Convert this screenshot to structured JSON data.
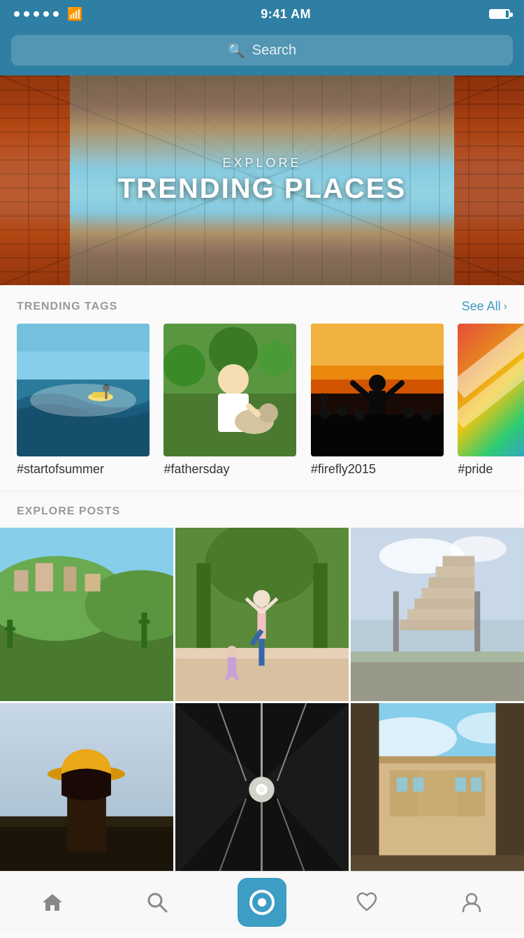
{
  "status_bar": {
    "time": "9:41 AM",
    "signal_dots": 5,
    "has_wifi": true,
    "battery_pct": 85
  },
  "search": {
    "placeholder": "Search"
  },
  "hero": {
    "explore_label": "EXPLORE",
    "title": "TRENDING PLACES"
  },
  "trending_tags": {
    "section_title": "TRENDING TAGS",
    "see_all_label": "See All",
    "tags": [
      {
        "name": "#startofsummer",
        "photo_class": "photo-surf"
      },
      {
        "name": "#fathersday",
        "photo_class": "photo-dog"
      },
      {
        "name": "#firefly2015",
        "photo_class": "photo-concert"
      },
      {
        "name": "#pride",
        "photo_class": "photo-pride"
      }
    ]
  },
  "explore_posts": {
    "section_title": "EXPLORE POSTS",
    "posts": [
      {
        "photo_class": "post-cityscape",
        "alt": "City hillside view"
      },
      {
        "photo_class": "post-yoga",
        "alt": "Yoga in garden"
      },
      {
        "photo_class": "post-stairs",
        "alt": "Outdoor stairs"
      },
      {
        "photo_class": "post-hat",
        "alt": "Woman with hat"
      },
      {
        "photo_class": "post-tunnel",
        "alt": "Tunnel lights"
      },
      {
        "photo_class": "post-building",
        "alt": "Building exterior"
      }
    ]
  },
  "bottom_nav": {
    "items": [
      {
        "name": "home",
        "icon": "⌂",
        "active": false
      },
      {
        "name": "search",
        "icon": "⌕",
        "active": false
      },
      {
        "name": "camera",
        "icon": "",
        "active": true
      },
      {
        "name": "heart",
        "icon": "♡",
        "active": false
      },
      {
        "name": "profile",
        "icon": "👤",
        "active": false
      }
    ]
  }
}
